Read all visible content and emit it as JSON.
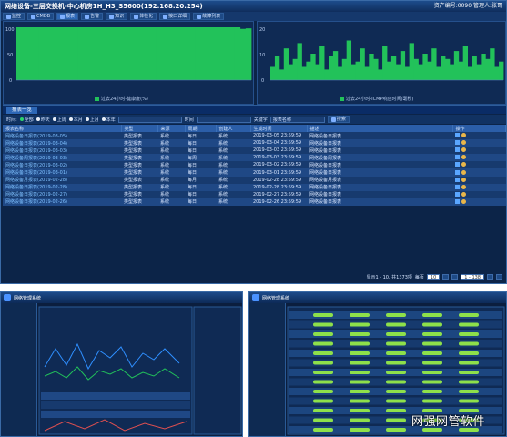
{
  "window": {
    "title": "网络设备-三层交换机-中心机房1H_H3_S5600(192.168.20.254)",
    "asset_no": "资产编号:0090",
    "admin": "管理人:张哥"
  },
  "toolbar": {
    "items": [
      {
        "label": "监控",
        "icon": "monitor-icon"
      },
      {
        "label": "CMDB",
        "icon": "database-icon"
      },
      {
        "label": "报表",
        "icon": "report-icon"
      },
      {
        "label": "告警",
        "icon": "alarm-icon"
      },
      {
        "label": "知识",
        "icon": "knowledge-icon"
      },
      {
        "label": "体检化",
        "icon": "check-icon"
      },
      {
        "label": "接口详细",
        "icon": "interface-icon"
      },
      {
        "label": "故障列表",
        "icon": "fault-icon"
      }
    ]
  },
  "charts": {
    "left_legend": "过去24小时-健康度(%)",
    "right_legend": "过去24小时-ICMP响应时间(毫秒)",
    "left_ymax": "100",
    "left_ymid": "50",
    "left_ymin": "0",
    "right_ymax": "20",
    "right_ymid": "10",
    "right_ymin": "0",
    "series_color": "#22c25a"
  },
  "chart_data": [
    {
      "type": "area",
      "title": "",
      "legend": [
        "过去24小时-健康度(%)"
      ],
      "ylim": [
        0,
        100
      ],
      "series": [
        {
          "name": "过去24小时-健康度(%)",
          "values": [
            100,
            100,
            100,
            100,
            100,
            100,
            100,
            100,
            100,
            100,
            100,
            100,
            100,
            100,
            100,
            100,
            100,
            100,
            100,
            100,
            100,
            100,
            100,
            100,
            100,
            100,
            100,
            100,
            100,
            100,
            100,
            100,
            100,
            100,
            100,
            100,
            100,
            100,
            100,
            100,
            97,
            98
          ]
        }
      ]
    },
    {
      "type": "area",
      "title": "",
      "legend": [
        "过去24小时-ICMP响应时间(毫秒)"
      ],
      "ylim": [
        0,
        20
      ],
      "series": [
        {
          "name": "过去24小时-ICMP响应时间(毫秒)",
          "values": [
            5,
            9,
            4,
            12,
            6,
            8,
            14,
            5,
            7,
            10,
            6,
            13,
            4,
            9,
            11,
            5,
            8,
            15,
            6,
            7,
            12,
            5,
            10,
            8,
            4,
            13,
            7,
            9,
            6,
            11,
            5,
            14,
            8,
            6,
            10,
            7,
            12,
            5,
            9,
            8,
            6,
            11,
            7,
            13,
            5,
            9,
            6,
            10,
            8,
            12,
            5,
            7
          ]
        }
      ]
    }
  ],
  "section": {
    "tab": "报表一览"
  },
  "filters": {
    "period_label": "时间:",
    "options": [
      "全部",
      "昨天",
      "上周",
      "本月",
      "上月",
      "本年"
    ],
    "selected": "全部",
    "date_label": "时间",
    "keyword_label": "关键字",
    "keyword_placeholder": "报表名称",
    "search_label": "搜索"
  },
  "table": {
    "headers": [
      "报表名称",
      "类型",
      "来源",
      "周期",
      "创建人",
      "生成时间",
      "描述",
      "操作"
    ],
    "rows": [
      [
        "网络设备日报表(2019-03-05)",
        "类型报表",
        "系统",
        "每日",
        "系统",
        "2019-03-05 23:59:59",
        "网络设备日报表"
      ],
      [
        "网络设备日报表(2019-03-04)",
        "类型报表",
        "系统",
        "每日",
        "系统",
        "2019-03-04 23:59:59",
        "网络设备日报表"
      ],
      [
        "网络设备日报表(2019-03-03)",
        "类型报表",
        "系统",
        "每日",
        "系统",
        "2019-03-03 23:59:59",
        "网络设备日报表"
      ],
      [
        "网络设备周报表(2019-03-03)",
        "类型报表",
        "系统",
        "每周",
        "系统",
        "2019-03-03 23:59:59",
        "网络设备周报表"
      ],
      [
        "网络设备日报表(2019-03-02)",
        "类型报表",
        "系统",
        "每日",
        "系统",
        "2019-03-02 23:59:59",
        "网络设备日报表"
      ],
      [
        "网络设备日报表(2019-03-01)",
        "类型报表",
        "系统",
        "每日",
        "系统",
        "2019-03-01 23:59:59",
        "网络设备日报表"
      ],
      [
        "网络设备月报表(2019-02-28)",
        "类型报表",
        "系统",
        "每月",
        "系统",
        "2019-02-28 23:59:59",
        "网络设备月报表"
      ],
      [
        "网络设备日报表(2019-02-28)",
        "类型报表",
        "系统",
        "每日",
        "系统",
        "2019-02-28 23:59:59",
        "网络设备日报表"
      ],
      [
        "网络设备日报表(2019-02-27)",
        "类型报表",
        "系统",
        "每日",
        "系统",
        "2019-02-27 23:59:59",
        "网络设备日报表"
      ],
      [
        "网络设备日报表(2019-02-26)",
        "类型报表",
        "系统",
        "每日",
        "系统",
        "2019-02-26 23:59:59",
        "网络设备日报表"
      ]
    ]
  },
  "pager": {
    "summary": "显示1 - 10, 共1373项",
    "per_page_label": "每页",
    "per_page": "10",
    "range": "1 - 138"
  },
  "thumbnails": {
    "left_title": "网络管理系统",
    "right_title": "网络管理系统"
  },
  "watermark": "网强网管软件"
}
